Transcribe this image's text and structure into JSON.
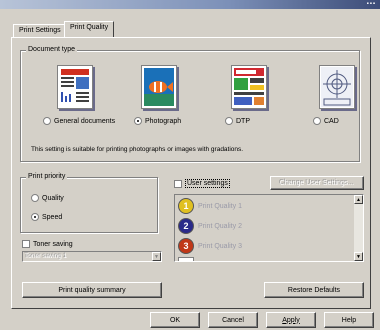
{
  "tabs": [
    {
      "label": "Print Settings"
    },
    {
      "label": "Print Quality"
    }
  ],
  "document_type": {
    "group_label": "Document type",
    "options": [
      {
        "label": "General documents",
        "icon": "general-documents-icon",
        "selected": false
      },
      {
        "label": "Photograph",
        "icon": "photograph-icon",
        "selected": true
      },
      {
        "label": "DTP",
        "icon": "dtp-icon",
        "selected": false
      },
      {
        "label": "CAD",
        "icon": "cad-icon",
        "selected": false
      }
    ],
    "description": "This setting is suitable for printing photographs or images with gradations."
  },
  "print_priority": {
    "group_label": "Print priority",
    "options": [
      {
        "label": "Quality",
        "selected": false
      },
      {
        "label": "Speed",
        "selected": true
      }
    ]
  },
  "toner_saving": {
    "label": "Toner saving",
    "checked": false,
    "select_value": "Toner saving 1"
  },
  "user_settings": {
    "label": "User settings",
    "checked": false,
    "change_button": "Change User Settings...",
    "items": [
      {
        "number": "1",
        "label": "Print Quality 1",
        "color": "#e0c020"
      },
      {
        "number": "2",
        "label": "Print Quality 2",
        "color": "#2a2a8a"
      },
      {
        "number": "3",
        "label": "Print Quality 3",
        "color": "#c03818"
      }
    ]
  },
  "buttons": {
    "summary": "Print quality summary",
    "restore": "Restore Defaults",
    "ok": "OK",
    "cancel": "Cancel",
    "apply": "Apply",
    "help": "Help"
  },
  "colors": {
    "dialog_bg": "#d4d0c8",
    "title_accent": "#3c4c78"
  }
}
